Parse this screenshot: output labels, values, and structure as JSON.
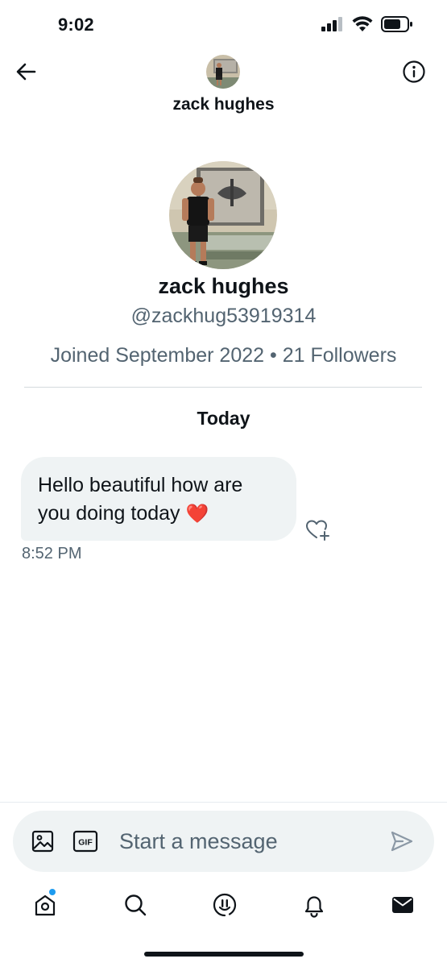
{
  "status_bar": {
    "time": "9:02"
  },
  "header": {
    "name": "zack hughes"
  },
  "profile": {
    "name": "zack hughes",
    "handle": "@zackhug53919314",
    "meta": "Joined September 2022 • 21 Followers"
  },
  "conversation": {
    "date_label": "Today",
    "messages": [
      {
        "text": "Hello beautiful how are you doing today",
        "emoji": "❤️",
        "time": "8:52 PM"
      }
    ]
  },
  "composer": {
    "placeholder": "Start a message",
    "gif_label": "GIF"
  },
  "tab_bar": {
    "items": [
      "home-icon",
      "search-icon",
      "spaces-icon",
      "notifications-icon",
      "messages-icon"
    ],
    "active": "messages-icon",
    "notification_dot_color": "#1d9bf0"
  },
  "colors": {
    "text_primary": "#0f1419",
    "text_secondary": "#536471",
    "bubble_bg": "#eff3f4",
    "accent": "#1d9bf0"
  }
}
